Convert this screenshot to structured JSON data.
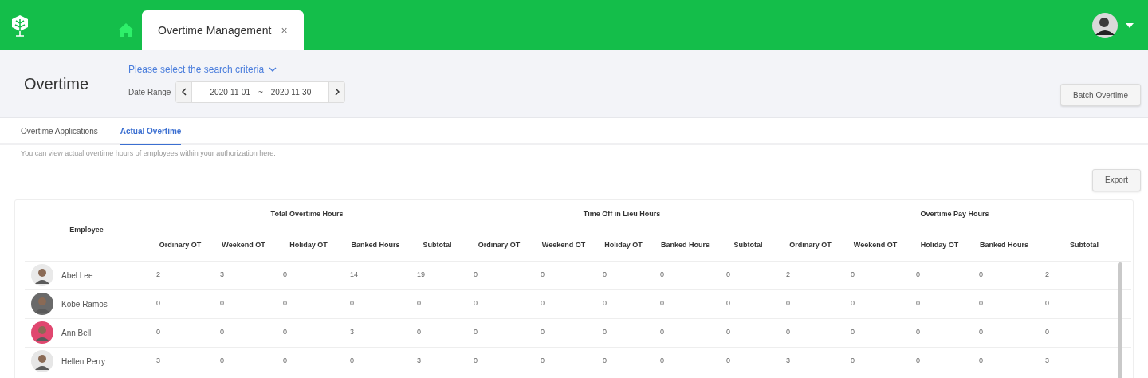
{
  "top_bar": {
    "tabs": [
      {
        "kind": "home",
        "selected": false
      },
      {
        "kind": "page",
        "label": "Overtime Management",
        "close": "×",
        "selected": true
      }
    ]
  },
  "header": {
    "title": "Overtime",
    "search_criteria": "Please select the search criteria",
    "date_range": {
      "label": "Date Range",
      "start": "2020-11-01",
      "separator": "~",
      "end": "2020-11-30"
    },
    "button": "Batch Overtime"
  },
  "tabs": [
    {
      "label": "Overtime Applications",
      "selected": false
    },
    {
      "label": "Actual Overtime",
      "selected": true
    }
  ],
  "description": "You can view actual overtime hours of employees within your authorization here.",
  "export_button": "Export",
  "table": {
    "employee_column": "Employee",
    "groups": [
      {
        "title": "Total Overtime Hours",
        "columns": [
          "Ordinary OT",
          "Weekend OT",
          "Holiday OT",
          "Banked Hours",
          "Subtotal"
        ]
      },
      {
        "title": "Time Off in Lieu Hours",
        "columns": [
          "Ordinary OT",
          "Weekend OT",
          "Holiday OT",
          "Banked Hours",
          "Subtotal"
        ]
      },
      {
        "title": "Overtime Pay Hours",
        "columns": [
          "Ordinary OT",
          "Weekend OT",
          "Holiday OT",
          "Banked Hours",
          "Subtotal"
        ]
      }
    ],
    "rows": [
      {
        "name": "Abel Lee",
        "values": [
          "2",
          "3",
          "0",
          "14",
          "19",
          "0",
          "0",
          "0",
          "0",
          "0",
          "2",
          "0",
          "0",
          "0",
          "2"
        ]
      },
      {
        "name": "Kobe Ramos",
        "values": [
          "0",
          "0",
          "0",
          "0",
          "0",
          "0",
          "0",
          "0",
          "0",
          "0",
          "0",
          "0",
          "0",
          "0",
          "0"
        ]
      },
      {
        "name": "Ann Bell",
        "values": [
          "0",
          "0",
          "0",
          "3",
          "0",
          "0",
          "0",
          "0",
          "0",
          "0",
          "0",
          "0",
          "0",
          "0",
          "0"
        ]
      },
      {
        "name": "Hellen Perry",
        "values": [
          "3",
          "0",
          "0",
          "0",
          "3",
          "0",
          "0",
          "0",
          "0",
          "0",
          "3",
          "0",
          "0",
          "0",
          "3"
        ]
      }
    ]
  }
}
